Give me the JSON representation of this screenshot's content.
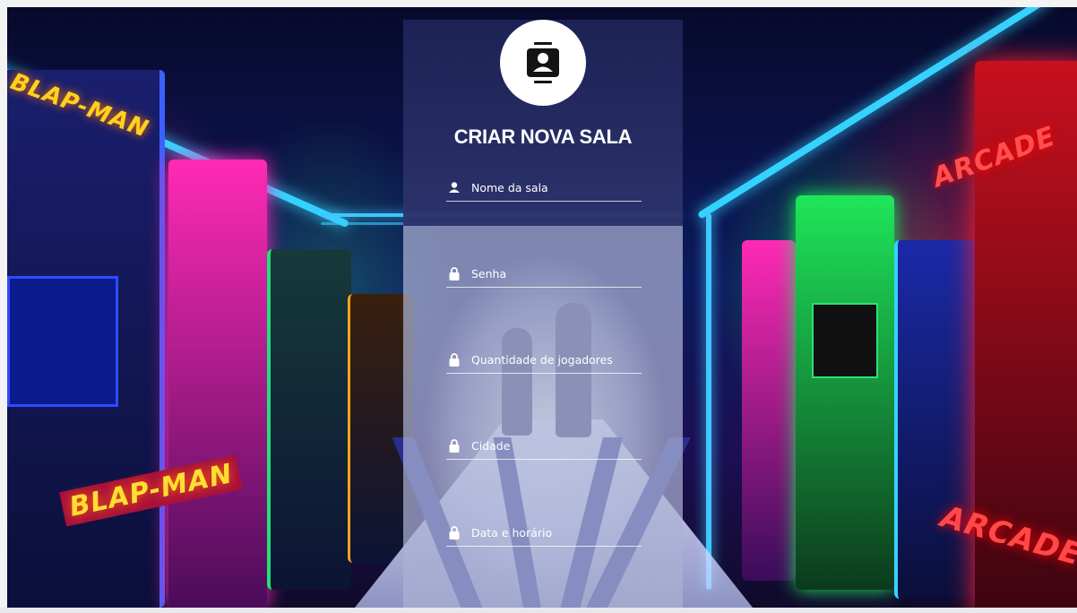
{
  "app": {
    "title": "CRIAR NOVA SALA",
    "avatar_icon": "contact-card-icon"
  },
  "form": {
    "fields": [
      {
        "name": "room-name",
        "icon": "user-icon",
        "placeholder": "Nome da sala",
        "value": ""
      },
      {
        "name": "password",
        "icon": "lock-icon",
        "placeholder": "Senha",
        "value": ""
      },
      {
        "name": "player-count",
        "icon": "lock-icon",
        "placeholder": "Quantidade de jogadores",
        "value": ""
      },
      {
        "name": "city",
        "icon": "lock-icon",
        "placeholder": "Cidade",
        "value": ""
      },
      {
        "name": "datetime",
        "icon": "lock-icon",
        "placeholder": "Data e horário",
        "value": ""
      }
    ]
  },
  "background": {
    "signs": [
      "BLAP-MAN",
      "BLAP-MAN",
      "ARCADE",
      "ARCADE"
    ],
    "colors": {
      "panel_header": "#141a4e",
      "panel_body": "#aab2d2",
      "neon_blue": "#1ec8ff",
      "neon_pink": "#ff2ab4",
      "neon_red": "#ff2030",
      "neon_green": "#1ee65a"
    }
  }
}
